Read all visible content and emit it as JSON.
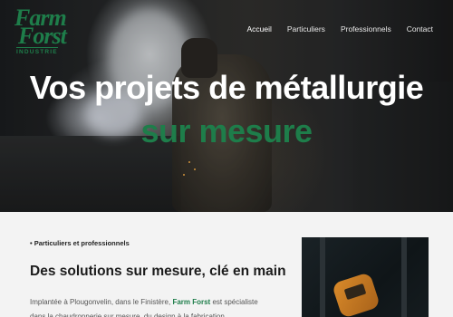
{
  "brand": {
    "line1": "Farm",
    "line2": "Forst",
    "sub": "INDUSTRIE",
    "color": "#1e7d4a"
  },
  "nav": {
    "items": [
      {
        "label": "Accueil",
        "active": true
      },
      {
        "label": "Particuliers",
        "active": false
      },
      {
        "label": "Professionnels",
        "active": false
      },
      {
        "label": "Contact",
        "active": false
      }
    ]
  },
  "hero": {
    "title": "Vos projets de métallurgie",
    "subtitle": "sur mesure"
  },
  "intro": {
    "tag": "• Particuliers et professionnels",
    "heading": "Des solutions sur mesure, clé en main",
    "para_before": "Implantée à Plougonvelin, dans le Finistère, ",
    "para_brand": "Farm Forst",
    "para_after": " est spécialiste dans la chaudronnerie sur mesure, du design à la fabrication."
  }
}
